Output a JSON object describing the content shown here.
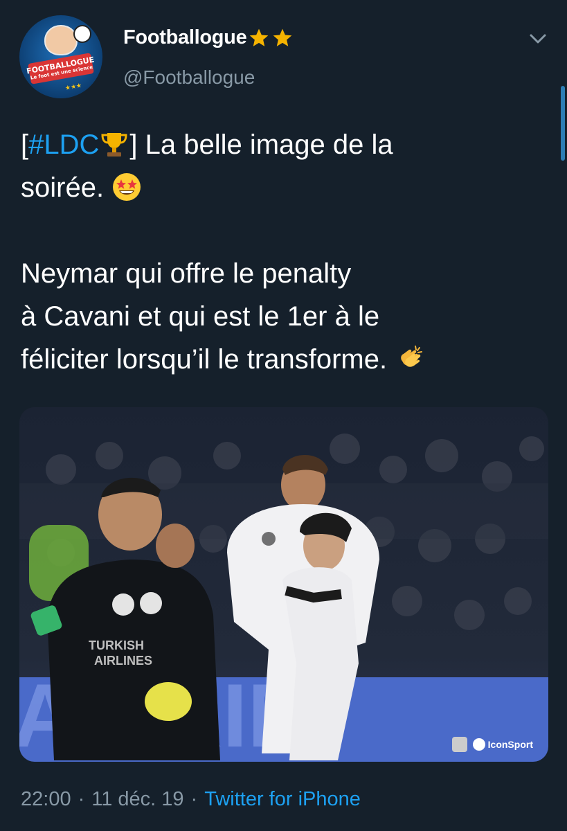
{
  "tweet": {
    "author": {
      "display_name": "Footballogue",
      "handle": "@Footballogue",
      "avatar_text": "FOOTBALLOGUE",
      "avatar_subtext": "Le foot est une science",
      "badge": "star-star-emoji"
    },
    "text": {
      "line1_open_bracket": "[",
      "hashtag": "#LDC",
      "trophy_icon": "trophy-emoji",
      "line1_rest": "] La belle image de la",
      "line2": "soirée.",
      "star_eyes_icon": "star-struck-emoji",
      "para2_line1": "Neymar qui offre le penalty",
      "para2_line2": "à Cavani et qui est le 1er à le",
      "para2_line3": "féliciter lorsqu’il le transforme.",
      "clap_icon": "clapping-hands-emoji"
    },
    "media": {
      "watermark": "IconSport"
    },
    "meta": {
      "time": "22:00",
      "date": "11 déc. 19",
      "separator": "·",
      "source": "Twitter for iPhone"
    }
  },
  "colors": {
    "background": "#15202b",
    "link": "#1da1f2",
    "secondary_text": "#8899a6",
    "star": "#f5b300"
  }
}
